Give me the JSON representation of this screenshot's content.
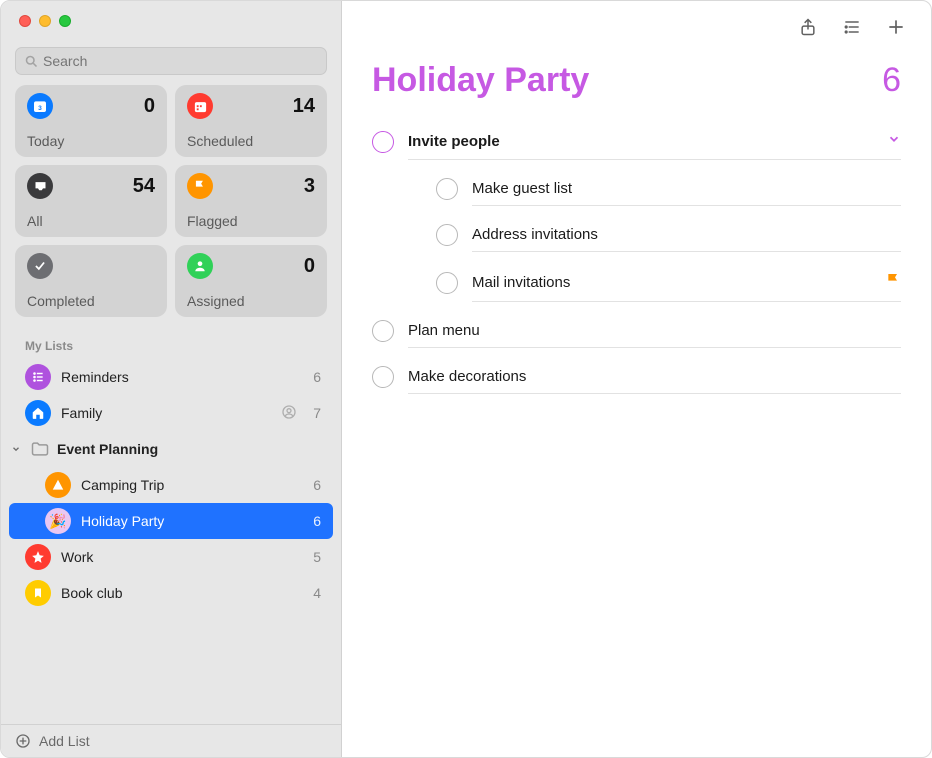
{
  "search": {
    "placeholder": "Search"
  },
  "smart": {
    "today": {
      "label": "Today",
      "count": 0
    },
    "scheduled": {
      "label": "Scheduled",
      "count": 14
    },
    "all": {
      "label": "All",
      "count": 54
    },
    "flagged": {
      "label": "Flagged",
      "count": 3
    },
    "completed": {
      "label": "Completed",
      "count": ""
    },
    "assigned": {
      "label": "Assigned",
      "count": 0
    }
  },
  "sidebar": {
    "my_lists_header": "My Lists",
    "reminders": {
      "label": "Reminders",
      "count": 6
    },
    "family": {
      "label": "Family",
      "count": 7
    },
    "event_planning": {
      "label": "Event Planning"
    },
    "camping": {
      "label": "Camping Trip",
      "count": 6
    },
    "holiday": {
      "label": "Holiday Party",
      "count": 6
    },
    "work": {
      "label": "Work",
      "count": 5
    },
    "bookclub": {
      "label": "Book club",
      "count": 4
    },
    "add_list": "Add List"
  },
  "main": {
    "title": "Holiday Party",
    "count": 6,
    "reminders": {
      "invite": "Invite people",
      "guest_list": "Make guest list",
      "address_inv": "Address invitations",
      "mail_inv": "Mail invitations",
      "plan_menu": "Plan menu",
      "decorations": "Make decorations"
    }
  }
}
